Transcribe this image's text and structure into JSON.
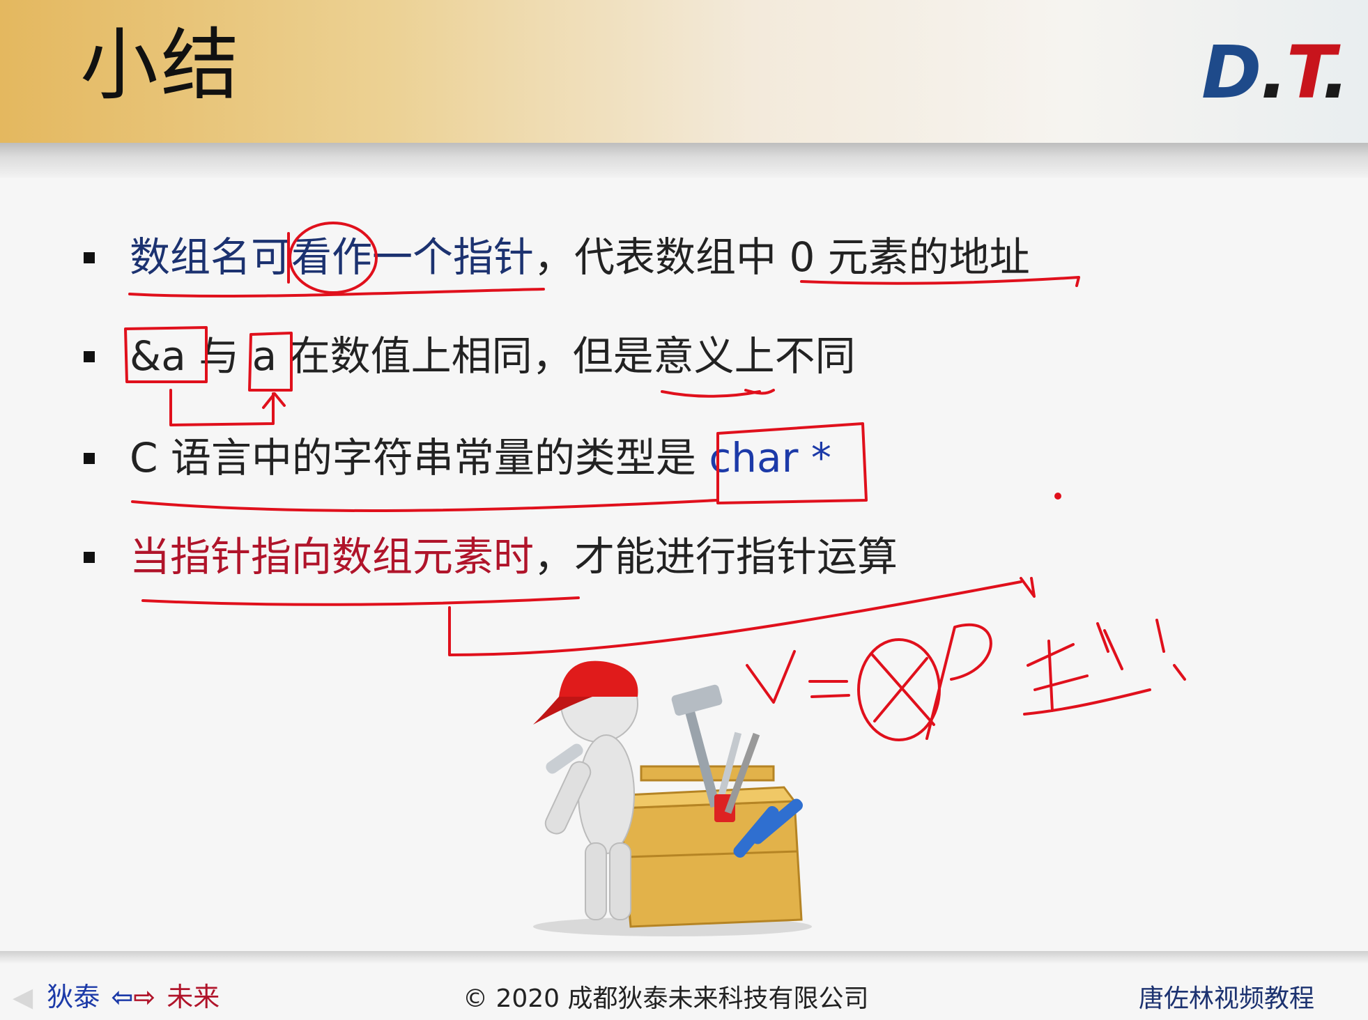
{
  "slide": {
    "title": "小结",
    "logo": {
      "d": "D",
      "dot1": ".",
      "t": "T",
      "dot2": "."
    },
    "bullets": [
      {
        "blue_part": "数组名可看作一个指针",
        "rest": "，代表数组中 0 元素的地址"
      },
      {
        "text": "&a 与 a 在数值上相同，但是意义上不同"
      },
      {
        "text": "C 语言中的字符串常量的类型是 ",
        "code": "char *"
      },
      {
        "red_part": "当指针指向数组元素时",
        "rest": "，才能进行指针运算"
      }
    ],
    "handwriting": "v=&p 针!",
    "illustration": "toolbox-mascot"
  },
  "footer": {
    "nav_left": "狄泰",
    "nav_arrow_left": "⇦",
    "nav_arrow_right": "⇨",
    "nav_right": "未来",
    "copyright": "© 2020 成都狄泰未来科技有限公司",
    "course": "唐佐林视频教程"
  },
  "colors": {
    "title_band": "#e4b85f",
    "blue_text": "#1c3270",
    "code_text": "#1c3aa8",
    "red_text": "#b0142a",
    "annotation_ink": "#e0101c"
  }
}
